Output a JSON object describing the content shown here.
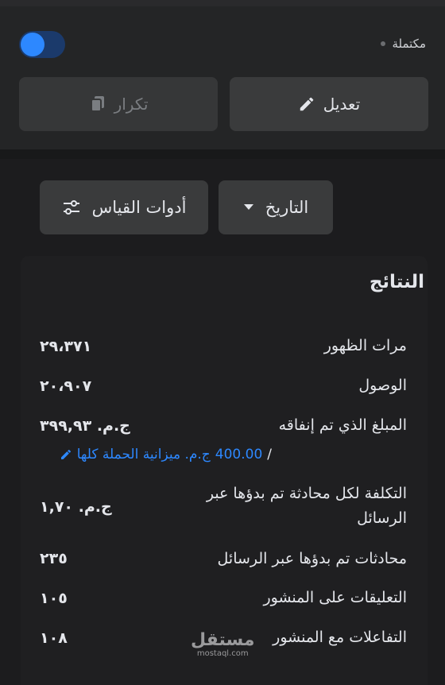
{
  "header": {
    "status_label": "مكتملة",
    "toggle_on": true,
    "edit_button_label": "تعديل",
    "duplicate_button_label": "تكرار"
  },
  "filters": {
    "date_label": "التاريخ",
    "metrics_label": "أدوات القياس"
  },
  "results": {
    "title": "النتائج",
    "rows": [
      {
        "label": "مرات الظهور",
        "value": "٢٩،٣٧١"
      },
      {
        "label": "الوصول",
        "value": "٢٠،٩٠٧"
      },
      {
        "label": "المبلغ الذي تم إنفاقه",
        "value": "ج.م. ٣٩٩,٩٣"
      },
      {
        "label": "التكلفة لكل محادثة تم بدؤها عبر الرسائل",
        "value": "ج.م. ١,٧٠"
      },
      {
        "label": "محادثات تم بدؤها عبر الرسائل",
        "value": "٢٣٥"
      },
      {
        "label": "التعليقات على المنشور",
        "value": "١٠٥"
      },
      {
        "label": "التفاعلات مع المنشور",
        "value": "١٠٨"
      }
    ],
    "budget_amount": "400.00",
    "budget_text": "ج.م. ميزانية الحملة كلها",
    "budget_slash": "/"
  },
  "watermark": {
    "main": "مستقل",
    "sub": "mostaql.com"
  },
  "colors": {
    "accent": "#2d88ff",
    "background": "#1c1c1e",
    "button": "#3a3b3c"
  }
}
